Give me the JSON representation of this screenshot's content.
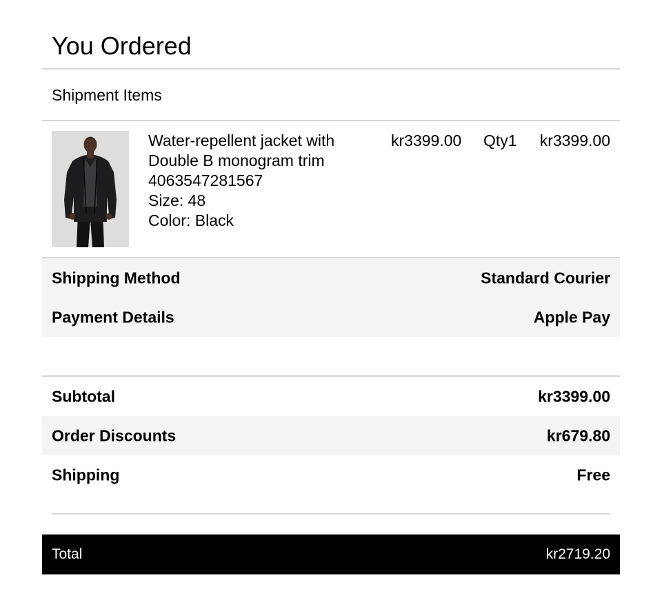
{
  "header": {
    "title": "You Ordered"
  },
  "shipment": {
    "heading": "Shipment Items",
    "items": [
      {
        "name_line1": "Water-repellent jacket with",
        "name_line2": "Double B monogram trim",
        "sku": "4063547281567",
        "size": "Size: 48",
        "color": "Color: Black",
        "unit_price": "kr3399.00",
        "qty": "Qty1",
        "line_total": "kr3399.00",
        "image": "product-photo-black-jacket"
      }
    ]
  },
  "details": {
    "shipping_method_label": "Shipping Method",
    "shipping_method_value": "Standard Courier",
    "payment_label": "Payment Details",
    "payment_value": "Apple Pay"
  },
  "summary": {
    "subtotal_label": "Subtotal",
    "subtotal_value": "kr3399.00",
    "discounts_label": "Order Discounts",
    "discounts_value": "kr679.80",
    "shipping_label": "Shipping",
    "shipping_value": "Free",
    "total_label": "Total",
    "total_value": "kr2719.20"
  },
  "colors": {
    "background": "#ffffff",
    "shaded_row": "#f4f4f4",
    "divider": "#d6d6d6",
    "total_bar": "#000000",
    "total_text": "#ffffff"
  }
}
